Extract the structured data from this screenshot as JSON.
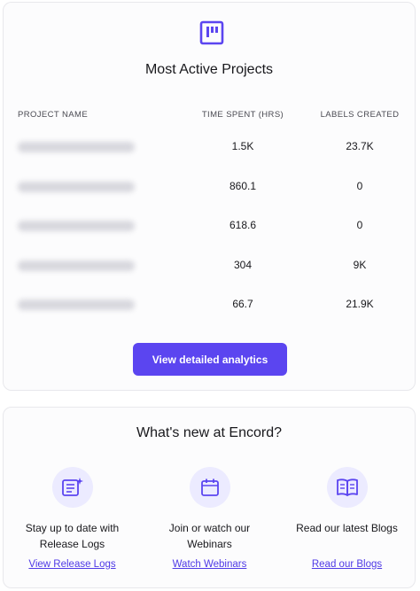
{
  "projects": {
    "title": "Most Active Projects",
    "headers": {
      "project_name": "PROJECT NAME",
      "time_spent": "TIME SPENT (HRS)",
      "labels_created": "LABELS CREATED"
    },
    "rows": [
      {
        "name": "",
        "time": "1.5K",
        "labels": "23.7K"
      },
      {
        "name": "",
        "time": "860.1",
        "labels": "0"
      },
      {
        "name": "",
        "time": "618.6",
        "labels": "0"
      },
      {
        "name": "",
        "time": "304",
        "labels": "9K"
      },
      {
        "name": "",
        "time": "66.7",
        "labels": "21.9K"
      }
    ],
    "button_label": "View detailed analytics"
  },
  "news": {
    "title": "What's new at Encord?",
    "items": [
      {
        "icon": "release-logs-icon",
        "line1": "Stay up to date with",
        "line2": "Release Logs",
        "link": "View Release Logs"
      },
      {
        "icon": "calendar-icon",
        "line1": "Join or watch our",
        "line2": "Webinars",
        "link": "Watch Webinars"
      },
      {
        "icon": "book-icon",
        "line1": "Read our latest Blogs",
        "line2": "",
        "link": "Read our Blogs"
      }
    ]
  },
  "colors": {
    "accent": "#5b45f0",
    "icon_bg": "#ecebff",
    "link": "#4f3ae6"
  }
}
